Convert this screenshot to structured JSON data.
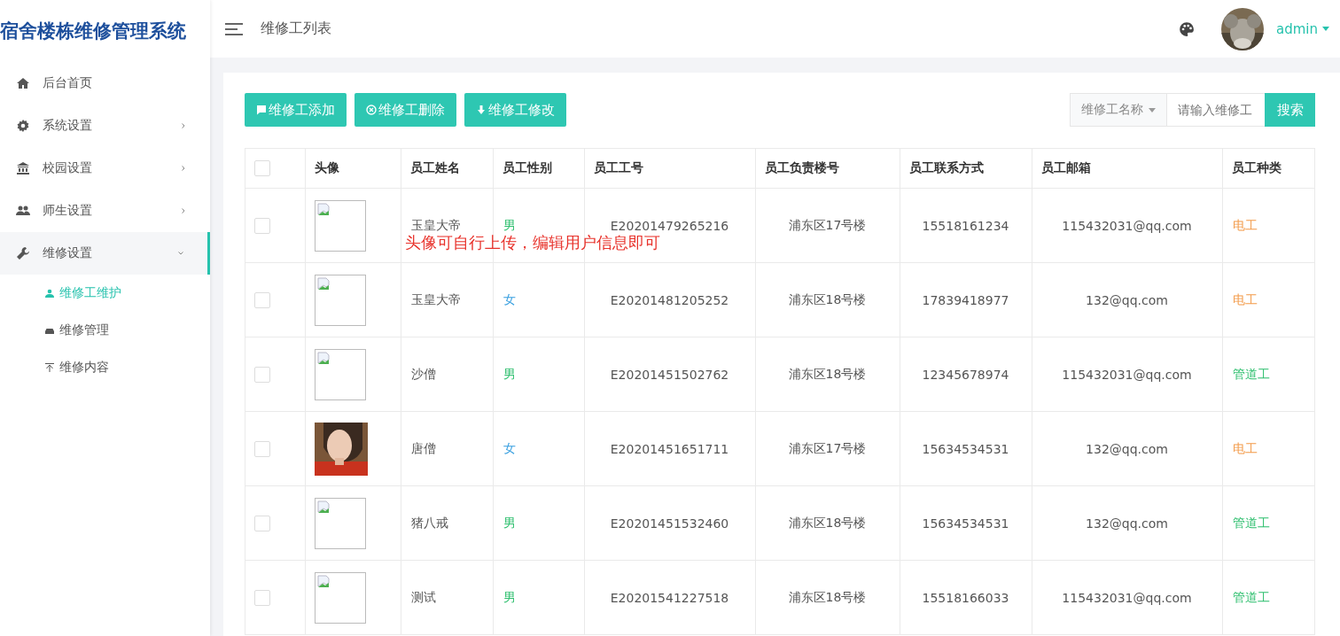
{
  "app_title": "宿舍楼栋维修管理系统",
  "sidebar": {
    "items": [
      {
        "label": "后台首页",
        "kind": "link",
        "expanded": false
      },
      {
        "label": "系统设置",
        "kind": "menu",
        "expanded": false
      },
      {
        "label": "校园设置",
        "kind": "menu",
        "expanded": false
      },
      {
        "label": "师生设置",
        "kind": "menu",
        "expanded": false
      },
      {
        "label": "维修设置",
        "kind": "menu",
        "expanded": true,
        "children": [
          {
            "label": "维修工维护",
            "selected": true
          },
          {
            "label": "维修管理",
            "selected": false
          },
          {
            "label": "维修内容",
            "selected": false
          }
        ]
      }
    ]
  },
  "header": {
    "breadcrumb": "维修工列表",
    "user": "admin"
  },
  "toolbar": {
    "buttons": [
      "维修工添加",
      "维修工删除",
      "维修工修改"
    ],
    "search": {
      "field_select": "维修工名称",
      "placeholder": "请输入维修工",
      "button": "搜索"
    }
  },
  "table": {
    "select_all": {
      "checked": false
    },
    "columns": [
      "头像",
      "员工姓名",
      "员工性别",
      "员工工号",
      "员工负责楼号",
      "员工联系方式",
      "员工邮箱",
      "员工种类"
    ],
    "rows": [
      {
        "checked": false,
        "avatar": {
          "kind": "broken"
        },
        "name": "玉皇大帝",
        "gender": {
          "text": "男",
          "color": "#2ebf6e"
        },
        "id": "E20201479265216",
        "building": "浦东区17号楼",
        "phone": "15518161234",
        "email": "115432031@qq.com",
        "type": {
          "text": "电工",
          "color": "#f39c4b"
        }
      },
      {
        "checked": false,
        "avatar": {
          "kind": "broken"
        },
        "name": "玉皇大帝",
        "gender": {
          "text": "女",
          "color": "#3aa0e0"
        },
        "id": "E20201481205252",
        "building": "浦东区18号楼",
        "phone": "17839418977",
        "email": "132@qq.com",
        "type": {
          "text": "电工",
          "color": "#f39c4b"
        }
      },
      {
        "checked": false,
        "avatar": {
          "kind": "broken"
        },
        "name": "沙僧",
        "gender": {
          "text": "男",
          "color": "#2ebf6e"
        },
        "id": "E20201451502762",
        "building": "浦东区18号楼",
        "phone": "12345678974",
        "email": "115432031@qq.com",
        "type": {
          "text": "管道工",
          "color": "#2ebf6e"
        }
      },
      {
        "checked": false,
        "name": "唐僧",
        "gender": {
          "text": "女",
          "color": "#3aa0e0"
        },
        "id": "E20201451651711",
        "building": "浦东区17号楼",
        "phone": "15634534531",
        "email": "132@qq.com",
        "type": {
          "text": "电工",
          "color": "#f39c4b"
        }
      },
      {
        "checked": false,
        "avatar": {
          "kind": "broken"
        },
        "name": "猪八戒",
        "gender": {
          "text": "男",
          "color": "#2ebf6e"
        },
        "id": "E20201451532460",
        "building": "浦东区18号楼",
        "phone": "15634534531",
        "email": "132@qq.com",
        "type": {
          "text": "管道工",
          "color": "#2ebf6e"
        }
      },
      {
        "checked": false,
        "avatar": {
          "kind": "broken"
        },
        "name": "测试",
        "gender": {
          "text": "男",
          "color": "#2ebf6e"
        },
        "id": "E20201541227518",
        "building": "浦东区18号楼",
        "phone": "15518166033",
        "email": "115432031@qq.com",
        "type": {
          "text": "管道工",
          "color": "#2ebf6e"
        }
      }
    ]
  },
  "annotation": "头像可自行上传，编辑用户信息即可"
}
